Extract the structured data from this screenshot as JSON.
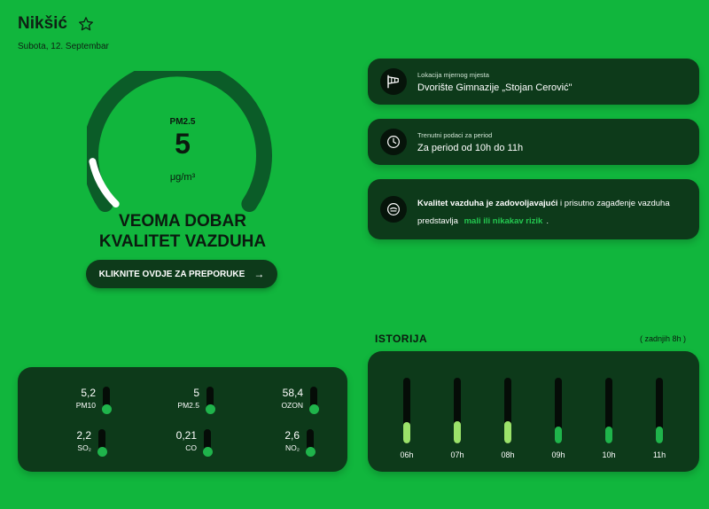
{
  "header": {
    "city": "Nikšić",
    "date": "Subota, 12. Septembar"
  },
  "gauge": {
    "label": "PM2.5",
    "value": "5",
    "unit": "μg/m³",
    "level_fraction": 0.12
  },
  "quality": {
    "line1": "VEOMA DOBAR",
    "line2": "KVALITET VAZDUHA"
  },
  "button": {
    "label": "KLIKNITE OVDJE ZA PREPORUKE",
    "arrow": "→"
  },
  "cards": {
    "location": {
      "small": "Lokacija mjernog mjesta",
      "main": "Dvorište Gimnazije „Stojan Cerović\""
    },
    "period": {
      "small": "Trenutni podaci za period",
      "main": "Za period od 10h do 11h"
    },
    "info": {
      "bold": "Kvalitet vazduha je zadovoljavajući",
      "text1": " i prisutno zagađenje vazduha predstavlja",
      "risk": "mali ili nikakav rizik",
      "text2": "."
    }
  },
  "pollutants": [
    {
      "value": "5,2",
      "name": "PM10"
    },
    {
      "value": "5",
      "name": "PM2.5"
    },
    {
      "value": "58,4",
      "name": "OZON"
    },
    {
      "value": "2,2",
      "name": "SO₂"
    },
    {
      "value": "0,21",
      "name": "CO"
    },
    {
      "value": "2,6",
      "name": "NO₂"
    }
  ],
  "history": {
    "title": "ISTORIJA",
    "subtitle": "( zadnjih 8h )",
    "hours": [
      {
        "label": "06h",
        "level": 0.32,
        "color": "#9be26a"
      },
      {
        "label": "07h",
        "level": 0.34,
        "color": "#9be26a"
      },
      {
        "label": "08h",
        "level": 0.34,
        "color": "#9be26a"
      },
      {
        "label": "09h",
        "level": 0.26,
        "color": "#1fb44b"
      },
      {
        "label": "10h",
        "level": 0.26,
        "color": "#1fb44b"
      },
      {
        "label": "11h",
        "level": 0.26,
        "color": "#1fb44b"
      }
    ]
  },
  "colors": {
    "background": "#11b63d",
    "card": "#0d3a1a",
    "accent": "#24c850"
  }
}
